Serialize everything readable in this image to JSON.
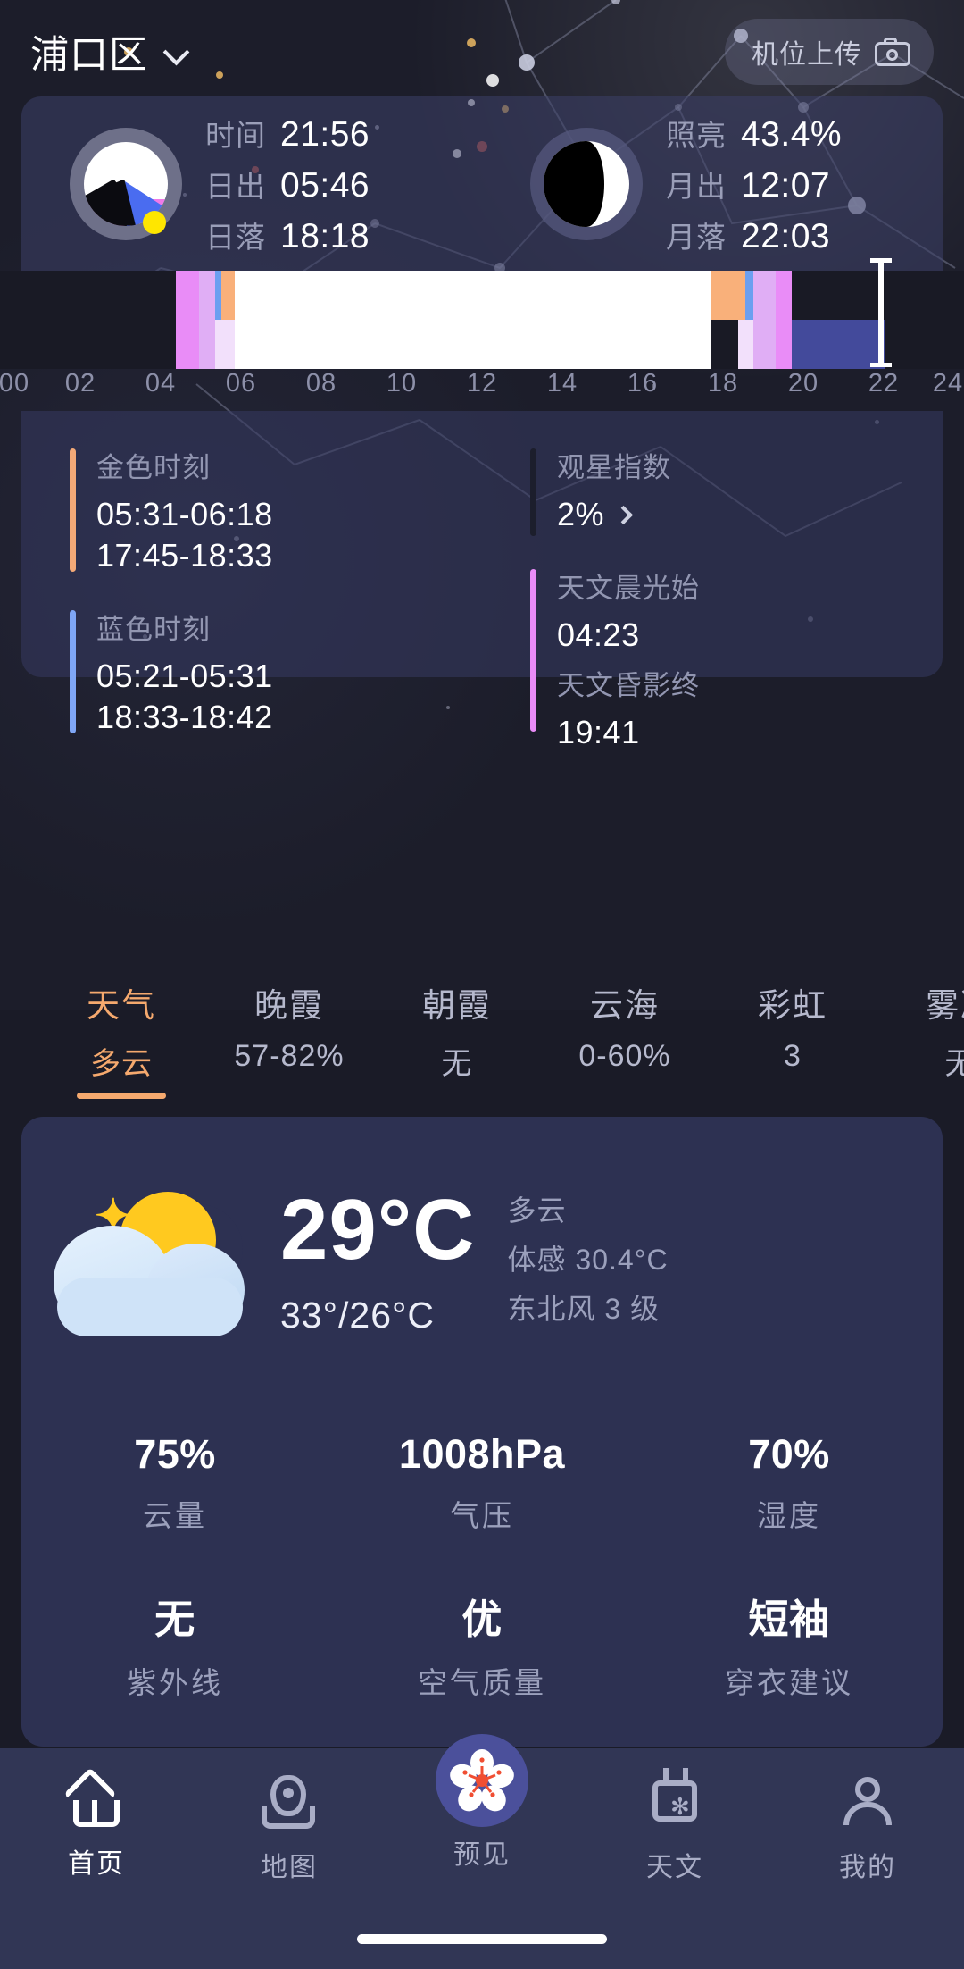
{
  "header": {
    "location": "浦口区",
    "chevron_icon": "chevron-down-icon",
    "upload_label": "机位上传",
    "camera_icon": "camera-icon"
  },
  "astro": {
    "sun": {
      "dial_icon": "sun-position-dial",
      "rows": [
        {
          "label": "时间",
          "value": "21:56"
        },
        {
          "label": "日出",
          "value": "05:46"
        },
        {
          "label": "日落",
          "value": "18:18"
        }
      ]
    },
    "moon": {
      "dial_icon": "moon-phase-dial",
      "rows": [
        {
          "label": "照亮",
          "value": "43.4%"
        },
        {
          "label": "月出",
          "value": "12:07"
        },
        {
          "label": "月落",
          "value": "22:03"
        }
      ]
    }
  },
  "timeline": {
    "hour_ticks": [
      "00",
      "02",
      "04",
      "06",
      "08",
      "10",
      "12",
      "14",
      "16",
      "18",
      "20",
      "22",
      "24"
    ],
    "cursor_hour": 21.93,
    "range": [
      0,
      24
    ],
    "bands": [
      {
        "name": "astronomical-dawn",
        "start": 4.38,
        "end": 4.95,
        "color": "#e98cf7",
        "span": "full"
      },
      {
        "name": "nautical-dawn",
        "start": 4.95,
        "end": 5.35,
        "color": "#e0aef5",
        "span": "full"
      },
      {
        "name": "civil-dawn-top",
        "start": 5.35,
        "end": 5.52,
        "color": "#6b9ff0",
        "span": "top"
      },
      {
        "name": "civil-dawn-bottom",
        "start": 5.35,
        "end": 5.85,
        "color": "#f2e0fb",
        "span": "bottom"
      },
      {
        "name": "golden-hour-morning",
        "start": 5.52,
        "end": 6.3,
        "color": "#f9b07a",
        "span": "top"
      },
      {
        "name": "day",
        "start": 5.85,
        "end": 17.72,
        "color": "#ffffff",
        "span": "full"
      },
      {
        "name": "golden-hour-evening",
        "start": 17.72,
        "end": 18.55,
        "color": "#f9b07a",
        "span": "top"
      },
      {
        "name": "civil-dusk-top",
        "start": 18.55,
        "end": 18.75,
        "color": "#6b9ff0",
        "span": "top"
      },
      {
        "name": "civil-dusk-bottom",
        "start": 18.38,
        "end": 18.95,
        "color": "#f2e0fb",
        "span": "bottom"
      },
      {
        "name": "nautical-dusk",
        "start": 18.75,
        "end": 19.3,
        "color": "#e0aef5",
        "span": "full"
      },
      {
        "name": "astronomical-dusk",
        "start": 19.3,
        "end": 19.72,
        "color": "#e98cf7",
        "span": "full"
      },
      {
        "name": "moon-up-night",
        "start": 19.72,
        "end": 22.05,
        "color": "#434a9b",
        "span": "bottom"
      }
    ]
  },
  "info": {
    "golden_hour": {
      "title": "金色时刻",
      "bar_color": "#f3a977",
      "ranges": [
        "05:31-06:18",
        "17:45-18:33"
      ]
    },
    "blue_hour": {
      "title": "蓝色时刻",
      "bar_color": "#7fa6f5",
      "ranges": [
        "05:21-05:31",
        "18:33-18:42"
      ]
    },
    "stargazing": {
      "title": "观星指数",
      "bar_color": "#1c1e2c",
      "value": "2%",
      "chevron_icon": "chevron-right-icon"
    },
    "astro_twilight": {
      "bar_color": "#e98cf7",
      "dawn_label": "天文晨光始",
      "dawn_value": "04:23",
      "dusk_label": "天文昏影终",
      "dusk_value": "19:41"
    }
  },
  "phenomena_tabs": {
    "active_index": 0,
    "items": [
      {
        "name": "天气",
        "value": "多云"
      },
      {
        "name": "晚霞",
        "value": "57-82%"
      },
      {
        "name": "朝霞",
        "value": "无"
      },
      {
        "name": "云海",
        "value": "0-60%"
      },
      {
        "name": "彩虹",
        "value": "3"
      },
      {
        "name": "雾凇",
        "value": "无"
      }
    ]
  },
  "weather": {
    "icon": "night-cloudy-icon",
    "temperature": "29°C",
    "range": "33°/26°C",
    "condition": "多云",
    "feels_like": "体感 30.4°C",
    "wind": "东北风 3 级",
    "metrics_row1": [
      {
        "value": "75%",
        "label": "云量"
      },
      {
        "value": "1008hPa",
        "label": "气压"
      },
      {
        "value": "70%",
        "label": "湿度"
      }
    ],
    "metrics_row2": [
      {
        "value": "无",
        "label": "紫外线"
      },
      {
        "value": "优",
        "label": "空气质量"
      },
      {
        "value": "短袖",
        "label": "穿衣建议"
      }
    ]
  },
  "bottom_nav": {
    "active_index": 0,
    "items": [
      {
        "label": "首页",
        "icon": "home-icon"
      },
      {
        "label": "地图",
        "icon": "map-pin-icon"
      },
      {
        "label": "预见",
        "icon": "flower-icon"
      },
      {
        "label": "天文",
        "icon": "calendar-star-icon"
      },
      {
        "label": "我的",
        "icon": "person-icon"
      }
    ]
  },
  "colors": {
    "page_bg": "#1c1d2a",
    "card_bg": "#2d3152",
    "accent": "#f5a96e",
    "nav_bg": "#313655"
  }
}
